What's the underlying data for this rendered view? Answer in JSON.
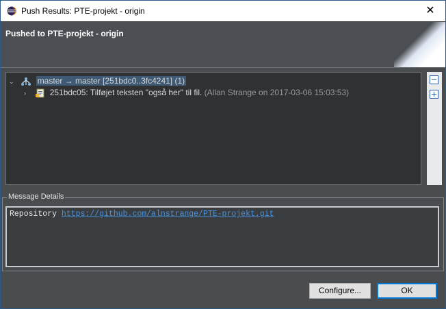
{
  "window": {
    "title": "Push Results: PTE-projekt - origin",
    "close_glyph": "✕"
  },
  "header": {
    "title": "Pushed to PTE-projekt - origin"
  },
  "tree": {
    "branch_row": {
      "toggle": "⌄",
      "icon": "branch-push-icon",
      "label": "master → master [251bdc0..3fc4241] (1)"
    },
    "commit_row": {
      "toggle": "›",
      "icon": "commit-icon",
      "label": "251bdc05: Tilføjet teksten \"også her\" til fil.",
      "meta": "(Allan Strange on 2017-03-06 15:03:53)"
    }
  },
  "side_buttons": {
    "collapse_icon": "collapse-all-icon",
    "expand_icon": "expand-all-icon"
  },
  "details": {
    "legend": "Message Details",
    "repository_label": "Repository",
    "repository_url": "https://github.com/alnstrange/PTE-projekt.git"
  },
  "buttons": {
    "configure": "Configure...",
    "ok": "OK"
  },
  "colors": {
    "background": "#4a4d50",
    "tree_bg": "#2f3133",
    "selection": "#3e5a74",
    "link": "#4a90d9",
    "default_button_border": "#0078d7"
  }
}
